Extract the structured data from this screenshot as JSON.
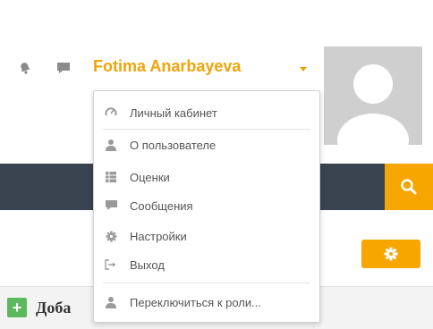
{
  "header": {
    "user_name": "Fotima Anarbayeva",
    "accent_color": "#f0a30a",
    "icons": [
      "bell-icon",
      "chat-icon",
      "caret-down-icon"
    ]
  },
  "user_menu": {
    "items": [
      {
        "label": "Личный кабинет",
        "icon": "dashboard-icon"
      },
      {
        "label": "О пользователе",
        "icon": "user-icon"
      },
      {
        "label": "Оценки",
        "icon": "grades-icon"
      },
      {
        "label": "Сообщения",
        "icon": "chat-icon"
      },
      {
        "label": "Настройки",
        "icon": "gear-icon"
      },
      {
        "label": "Выход",
        "icon": "logout-icon"
      },
      {
        "label": "Переключиться к роли...",
        "icon": "user-icon"
      }
    ]
  },
  "navbar": {
    "color": "#3a4451",
    "search_icon": "search-icon"
  },
  "block": {
    "add_label_visible": "Доба",
    "settings_icon": "gear-icon"
  }
}
